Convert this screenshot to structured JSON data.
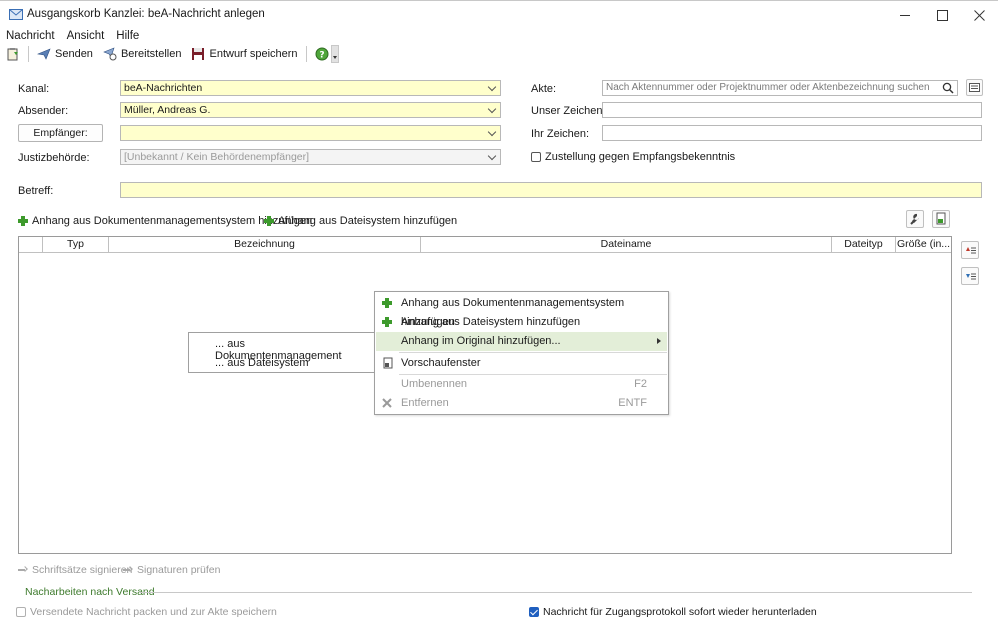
{
  "window": {
    "title": "Ausgangskorb Kanzlei: beA-Nachricht anlegen"
  },
  "menubar": {
    "items": [
      "Nachricht",
      "Ansicht",
      "Hilfe"
    ]
  },
  "toolbar": {
    "send_label": "Senden",
    "provide_label": "Bereitstellen",
    "save_draft_label": "Entwurf speichern"
  },
  "form": {
    "kanal_label": "Kanal:",
    "kanal_value": "beA-Nachrichten",
    "absender_label": "Absender:",
    "absender_value": "Müller, Andreas G.",
    "empfaenger_button": "Empfänger:",
    "empfaenger_value": "",
    "justiz_label": "Justizbehörde:",
    "justiz_value": "[Unbekannt / Kein Behördenempfänger]",
    "akte_label": "Akte:",
    "akte_placeholder": "Nach Aktennummer oder Projektnummer oder Aktenbezeichnung suchen",
    "unser_zeichen_label": "Unser Zeichen:",
    "ihr_zeichen_label": "Ihr Zeichen:",
    "zustellung_label": "Zustellung gegen Empfangsbekenntnis",
    "zustellung_checked": false,
    "betreff_label": "Betreff:",
    "betreff_value": ""
  },
  "attachments": {
    "add_dms_label": "Anhang aus Dokumentenmanagementsystem hinzufügen",
    "add_fs_label": "Anhang aus Dateisystem hinzufügen",
    "columns": [
      "Typ",
      "Bezeichnung",
      "Dateiname",
      "Dateityp",
      "Größe (in..."
    ]
  },
  "context_menu": {
    "items": [
      {
        "label": "Anhang aus Dokumentenmanagementsystem hinzufügen",
        "icon": "plus-icon",
        "enabled": true
      },
      {
        "label": "Anhang aus Dateisystem hinzufügen",
        "icon": "plus-icon",
        "enabled": true
      },
      {
        "label": "Anhang im Original hinzufügen...",
        "icon": "",
        "enabled": true,
        "highlighted": true,
        "submenu": true
      },
      {
        "label": "Vorschaufenster",
        "icon": "preview-icon",
        "enabled": true
      },
      {
        "label": "Umbenennen",
        "shortcut": "F2",
        "enabled": false
      },
      {
        "label": "Entfernen",
        "shortcut": "ENTF",
        "icon": "delete-icon",
        "enabled": false
      }
    ]
  },
  "submenu": {
    "items": [
      "... aus Dokumentenmanagement",
      "... aus Dateisystem"
    ]
  },
  "footer": {
    "sign_label": "Schriftsätze signieren",
    "verify_label": "Signaturen prüfen",
    "section_title": "Nacharbeiten nach Versand",
    "pack_label": "Versendete Nachricht packen und zur Akte speichern",
    "pack_checked": false,
    "protocol_label": "Nachricht für Zugangsprotokoll sofort wieder herunterladen",
    "protocol_checked": true
  },
  "colors": {
    "required_field": "#ffffcc",
    "menu_highlight": "#e3eed8",
    "plus_green": "#3d9a2c",
    "section_green": "#3d7a2c"
  }
}
